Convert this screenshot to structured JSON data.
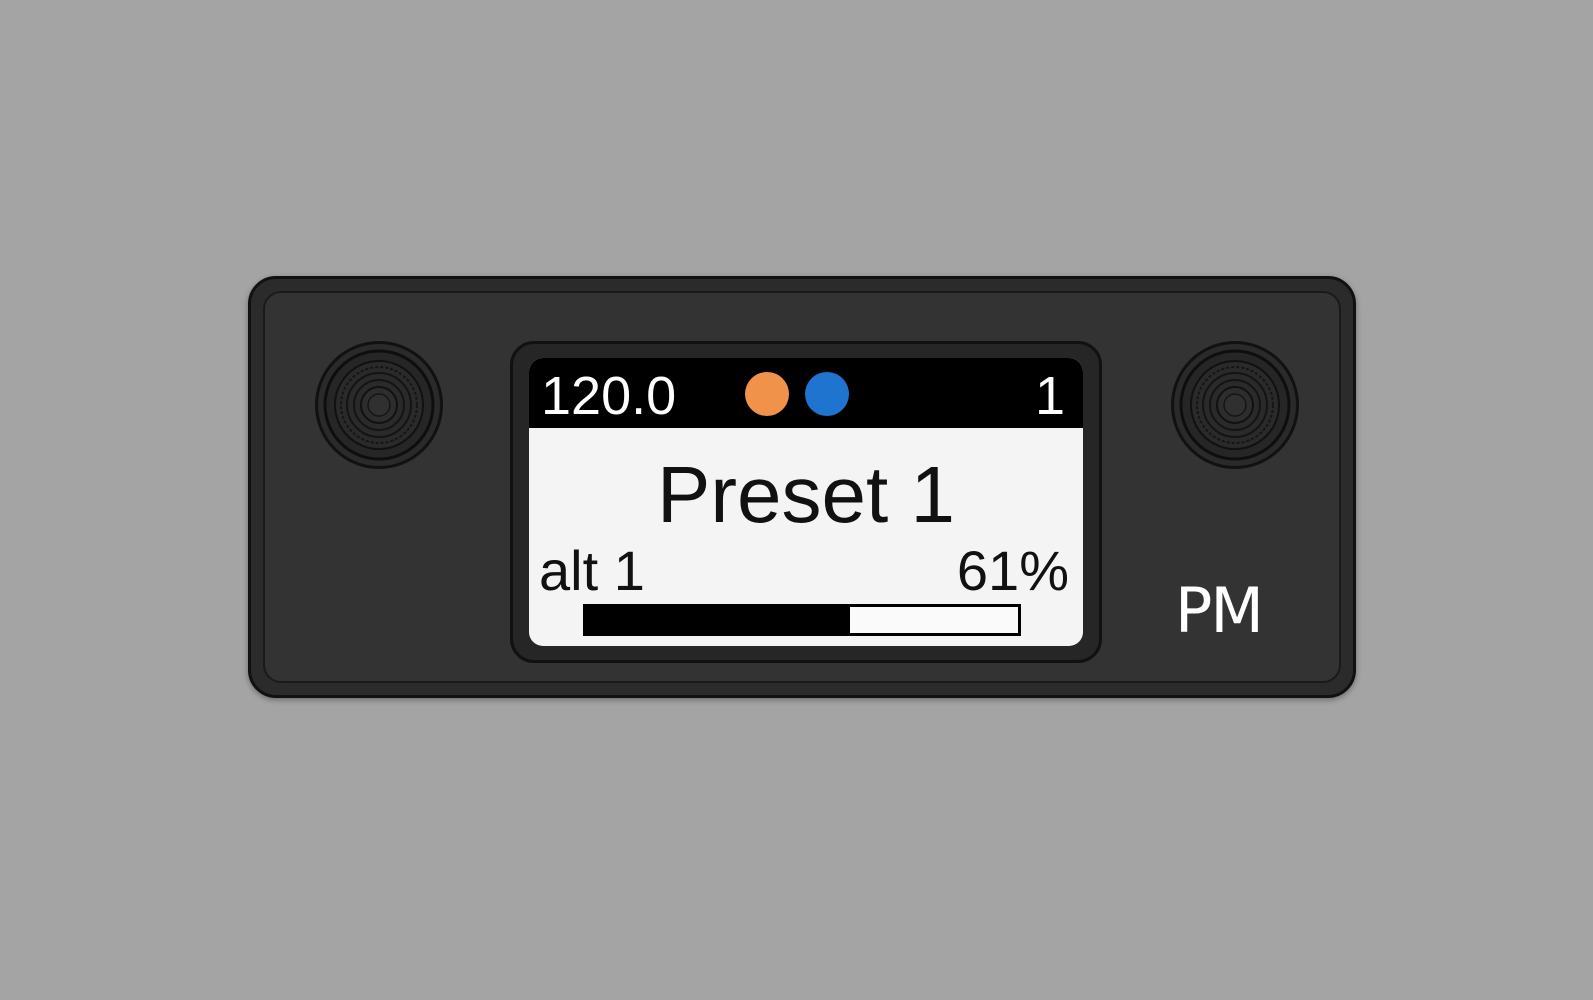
{
  "device": {
    "logo_text": "PM",
    "screen": {
      "header": {
        "tempo": "120.0",
        "bank_number": "1",
        "indicators": [
          {
            "name": "orange-indicator",
            "color": "#f0924a"
          },
          {
            "name": "blue-indicator",
            "color": "#1f74d0"
          }
        ]
      },
      "preset_name": "Preset 1",
      "alt_label": "alt 1",
      "level_percent_label": "61%",
      "level_fraction": 0.61
    },
    "colors": {
      "housing": "#2b2b2b",
      "screen_bg": "#f4f4f4",
      "header_bg": "#000000",
      "background": "#a4a4a4"
    }
  }
}
